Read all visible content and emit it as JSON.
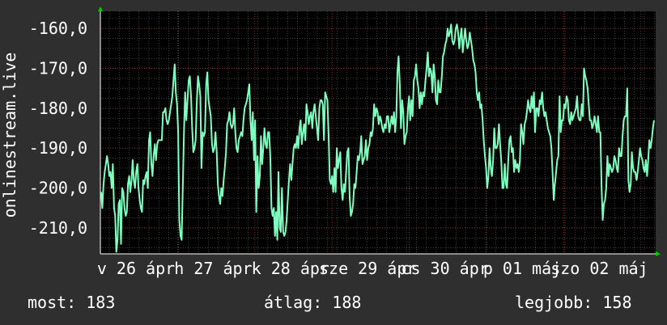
{
  "chart_data": {
    "type": "line",
    "ylabel": "onlinestream.live",
    "ylim": [
      -216.5,
      -155.7
    ],
    "yticks": [
      -160,
      -170,
      -180,
      -190,
      -200,
      -210
    ],
    "ytick_labels": [
      "-160,0",
      "-170,0",
      "-180,0",
      "-190,0",
      "-200,0",
      "-210,0"
    ],
    "xtick_labels": [
      "v 26 ápr",
      "h 27 ápr",
      "k 28 ápr",
      "sze 29 ápr",
      "cs 30 ápr",
      "p 01 máj",
      "szo 02 máj"
    ],
    "grid": true,
    "series": [
      {
        "color": "#7fffbf",
        "y": [
          -201,
          -205,
          -199,
          -196,
          -194,
          -192,
          -194,
          -197,
          -196,
          -200,
          -194,
          -205,
          -207,
          -216,
          -213,
          -204,
          -203,
          -214,
          -200,
          -201,
          -205,
          -207,
          -206,
          -199,
          -197,
          -201,
          -198,
          -193,
          -198,
          -200,
          -196,
          -194,
          -200,
          -203,
          -205,
          -206,
          -198,
          -199,
          -197,
          -196,
          -200,
          -188,
          -186,
          -194,
          -197,
          -192,
          -189,
          -193,
          -189,
          -188,
          -188,
          -188,
          -188,
          -181,
          -181,
          -180,
          -183,
          -184,
          -183,
          -181,
          -179,
          -177,
          -173,
          -169,
          -176,
          -179,
          -186,
          -208,
          -212,
          -213,
          -199,
          -186,
          -176,
          -183,
          -178,
          -173,
          -172,
          -177,
          -185,
          -191,
          -190,
          -188,
          -178,
          -172,
          -174,
          -177,
          -195,
          -186,
          -187,
          -186,
          -174,
          -171,
          -178,
          -180,
          -182,
          -189,
          -191,
          -190,
          -186,
          -191,
          -199,
          -202,
          -204,
          -200,
          -202,
          -198,
          -195,
          -191,
          -184,
          -183,
          -181,
          -184,
          -185,
          -184,
          -180,
          -186,
          -190,
          -191,
          -188,
          -187,
          -186,
          -187,
          -183,
          -180,
          -179,
          -178,
          -176,
          -174,
          -183,
          -188,
          -181,
          -193,
          -183,
          -206,
          -192,
          -200,
          -197,
          -187,
          -194,
          -190,
          -185,
          -189,
          -190,
          -186,
          -186,
          -192,
          -205,
          -207,
          -205,
          -212,
          -206,
          -213,
          -196,
          -210,
          -211,
          -200,
          -211,
          -212,
          -211,
          -208,
          -203,
          -198,
          -194,
          -198,
          -194,
          -190,
          -189,
          -190,
          -187,
          -190,
          -185,
          -183,
          -189,
          -186,
          -184,
          -188,
          -179,
          -181,
          -184,
          -182,
          -181,
          -185,
          -181,
          -179,
          -182,
          -185,
          -188,
          -180,
          -178,
          -178,
          -179,
          -188,
          -176,
          -177,
          -178,
          -187,
          -198,
          -199,
          -197,
          -201,
          -195,
          -201,
          -190,
          -195,
          -193,
          -191,
          -200,
          -203,
          -199,
          -201,
          -196,
          -191,
          -190,
          -202,
          -207,
          -206,
          -204,
          -199,
          -200,
          -196,
          -192,
          -193,
          -191,
          -187,
          -194,
          -193,
          -192,
          -188,
          -193,
          -190,
          -189,
          -186,
          -187,
          -185,
          -179,
          -182,
          -180,
          -181,
          -184,
          -182,
          -183,
          -185,
          -186,
          -184,
          -185,
          -182,
          -182,
          -186,
          -184,
          -182,
          -184,
          -181,
          -186,
          -182,
          -171,
          -167,
          -174,
          -185,
          -178,
          -181,
          -189,
          -187,
          -186,
          -180,
          -177,
          -183,
          -178,
          -182,
          -173,
          -172,
          -169,
          -173,
          -175,
          -180,
          -176,
          -179,
          -176,
          -177,
          -173,
          -170,
          -166,
          -172,
          -170,
          -171,
          -176,
          -169,
          -172,
          -178,
          -179,
          -173,
          -176,
          -176,
          -172,
          -167,
          -166,
          -164,
          -163,
          -160,
          -162,
          -161,
          -159,
          -163,
          -164,
          -163,
          -160,
          -159,
          -161,
          -165,
          -162,
          -160,
          -166,
          -163,
          -160,
          -163,
          -165,
          -164,
          -161,
          -163,
          -165,
          -168,
          -169,
          -171,
          -176,
          -178,
          -176,
          -180,
          -179,
          -183,
          -188,
          -192,
          -195,
          -200,
          -197,
          -190,
          -195,
          -197,
          -193,
          -185,
          -190,
          -190,
          -189,
          -184,
          -189,
          -193,
          -200,
          -200,
          -194,
          -199,
          -200,
          -193,
          -188,
          -187,
          -191,
          -190,
          -196,
          -193,
          -195,
          -194,
          -196,
          -193,
          -184,
          -186,
          -189,
          -184,
          -183,
          -181,
          -178,
          -180,
          -181,
          -177,
          -180,
          -176,
          -186,
          -180,
          -180,
          -182,
          -178,
          -179,
          -176,
          -180,
          -182,
          -181,
          -183,
          -185,
          -186,
          -187,
          -190,
          -196,
          -203,
          -199,
          -196,
          -193,
          -192,
          -177,
          -186,
          -183,
          -183,
          -179,
          -180,
          -177,
          -178,
          -183,
          -184,
          -181,
          -183,
          -182,
          -181,
          -180,
          -177,
          -182,
          -183,
          -183,
          -179,
          -182,
          -170,
          -172,
          -173,
          -175,
          -179,
          -183,
          -183,
          -185,
          -184,
          -182,
          -184,
          -186,
          -182,
          -186,
          -186,
          -200,
          -208,
          -204,
          -203,
          -200,
          -192,
          -197,
          -194,
          -195,
          -196,
          -195,
          -192,
          -193,
          -195,
          -196,
          -190,
          -192,
          -192,
          -187,
          -183,
          -182,
          -182,
          -175,
          -198,
          -201,
          -199,
          -191,
          -195,
          -196,
          -196,
          -198,
          -196,
          -193,
          -190,
          -192,
          -193,
          -195,
          -196,
          -193,
          -197,
          -193,
          -188,
          -190,
          -188,
          -185,
          -183
        ]
      }
    ]
  },
  "stats": {
    "current": "most: 183",
    "average": "átlag: 188",
    "best": "legjobb: 158"
  }
}
